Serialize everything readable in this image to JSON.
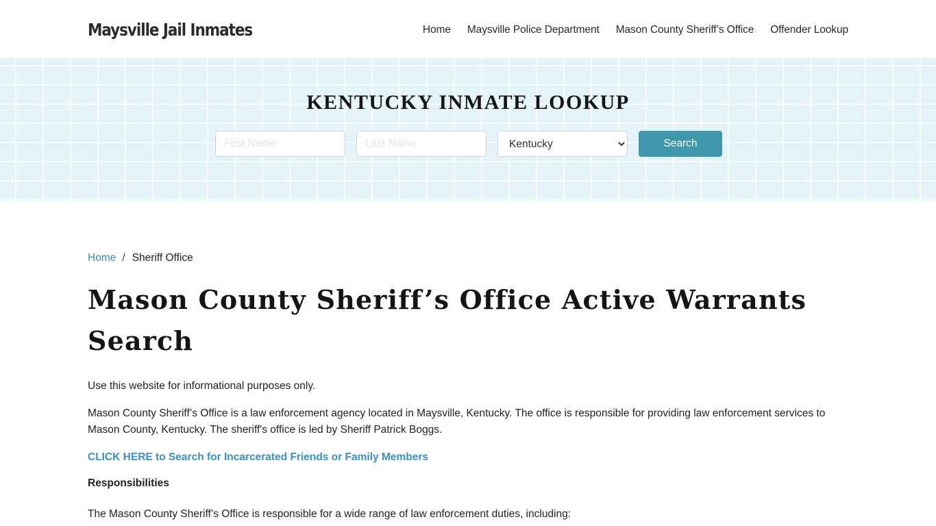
{
  "header": {
    "logo": "Maysville Jail Inmates",
    "nav": [
      {
        "label": "Home"
      },
      {
        "label": "Maysville Police Department"
      },
      {
        "label": "Mason County Sheriff’s Office"
      },
      {
        "label": "Offender Lookup"
      }
    ]
  },
  "banner": {
    "title": "KENTUCKY INMATE LOOKUP",
    "first_name_placeholder": "First Name",
    "first_name_value": "",
    "last_name_placeholder": "Last Name",
    "last_name_value": "",
    "state_selected": "Kentucky",
    "search_label": "Search",
    "colors": {
      "background": "#e3f3f7",
      "button": "#4096ab"
    }
  },
  "breadcrumb": {
    "home": "Home",
    "separator": "/",
    "current": "Sheriff Office"
  },
  "main": {
    "title": "Mason County Sheriff’s Office Active Warrants Search",
    "note": "Use this website for informational purposes only.",
    "description": "Mason County Sheriff’s Office is a law enforcement agency located in Maysville, Kentucky. The office is responsible for providing law enforcement services to Mason County, Kentucky. The sheriff's office is led by Sheriff Patrick Boggs.",
    "cta_link": "CLICK HERE to Search for Incarcerated Friends or Family Members",
    "responsibilities_heading": "Responsibilities",
    "duties_intro": "The Mason County Sheriff’s Office is responsible for a wide range of law enforcement duties, including:",
    "colors": {
      "link": "#3a8fc6",
      "breadcrumb_link": "#3d8ba1"
    }
  }
}
